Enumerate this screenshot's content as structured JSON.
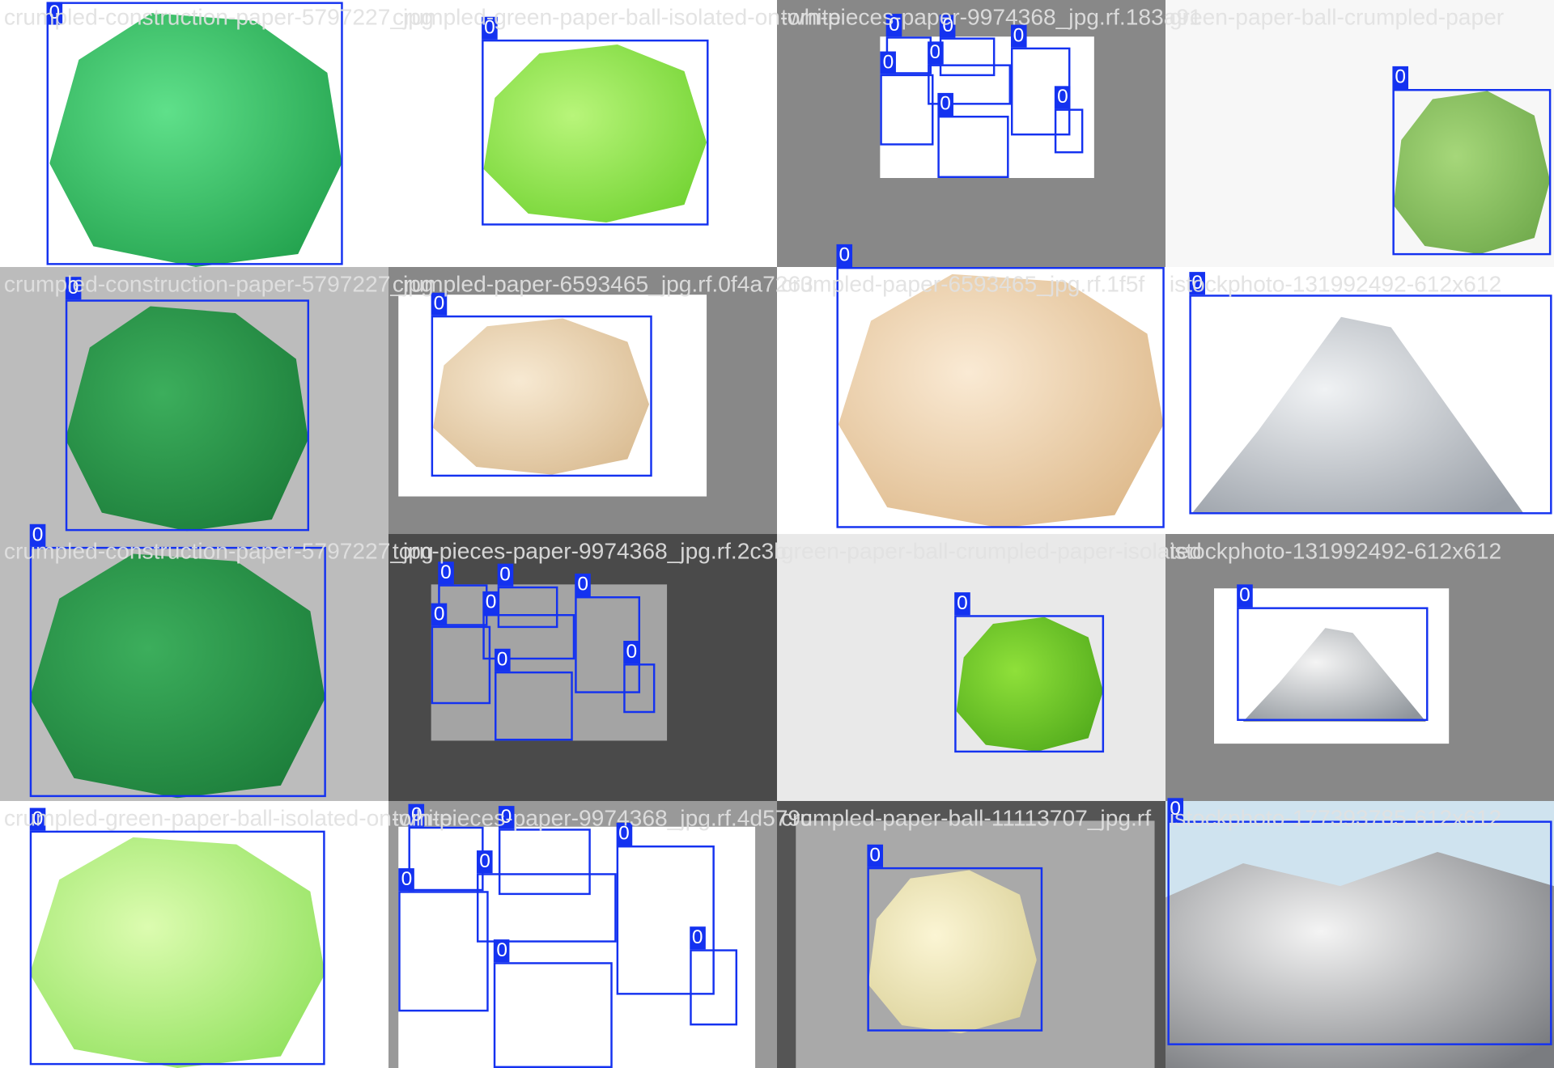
{
  "class_label": "0",
  "box_color": "#1432f0",
  "tiles": [
    {
      "filename": "crumpled-construction-paper-5797227_jpg"
    },
    {
      "filename": "crumpled-green-paper-ball-isolated-on-white"
    },
    {
      "filename": "torn-pieces-paper-9974368_jpg.rf.183a91"
    },
    {
      "filename": "green-paper-ball-crumpled-paper"
    },
    {
      "filename": "crumpled-construction-paper-5797227_jpg"
    },
    {
      "filename": "crumpled-paper-6593465_jpg.rf.0f4a7263"
    },
    {
      "filename": "crumpled-paper-6593465_jpg.rf.1f5f"
    },
    {
      "filename": "istockphoto-131992492-612x612"
    },
    {
      "filename": "crumpled-construction-paper-5797227_jpg"
    },
    {
      "filename": "torn-pieces-paper-9974368_jpg.rf.2c3b"
    },
    {
      "filename": "green-paper-ball-crumpled-paper-isolated"
    },
    {
      "filename": "istockphoto-131992492-612x612"
    },
    {
      "filename": "crumpled-green-paper-ball-isolated-on-white"
    },
    {
      "filename": "torn-pieces-paper-9974368_jpg.rf.4d579c"
    },
    {
      "filename": "crumpled-paper-ball-11113707_jpg.rf"
    },
    {
      "filename": "istockphoto-177393785-612x612"
    }
  ]
}
